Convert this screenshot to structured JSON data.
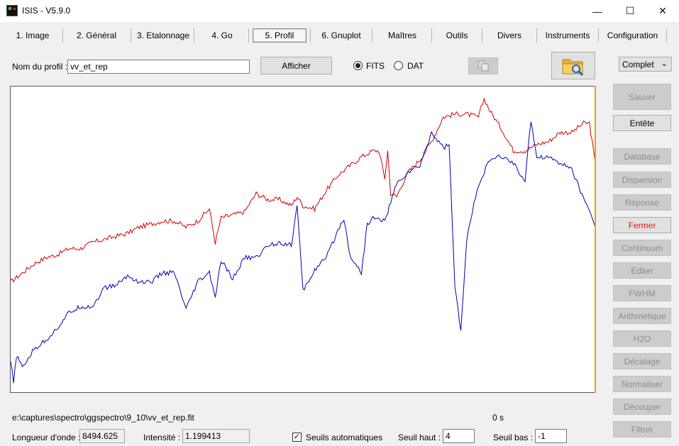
{
  "window": {
    "title": "ISIS - V5.9.0",
    "minimize_glyph": "—",
    "maximize_glyph": "☐",
    "close_glyph": "✕"
  },
  "tabs": [
    {
      "label": "1. Image"
    },
    {
      "label": "2. Général"
    },
    {
      "label": "3. Etalonnage"
    },
    {
      "label": "4. Go"
    },
    {
      "label": "5. Profil",
      "active": true
    },
    {
      "label": "6. Gnuplot"
    },
    {
      "label": "Maîtres"
    },
    {
      "label": "Outils"
    },
    {
      "label": "Divers"
    },
    {
      "label": "Instruments"
    },
    {
      "label": "Configuration"
    }
  ],
  "profile": {
    "name_label": "Nom du profil :",
    "name_value": "vv_et_rep",
    "show_button": "Afficher",
    "format_fits": "FITS",
    "format_dat": "DAT",
    "format_selected": "FITS"
  },
  "view_select": {
    "value": "Complet"
  },
  "side_buttons": [
    {
      "label": "Sauver",
      "enabled": false
    },
    {
      "label": "Entête",
      "enabled": true
    },
    {
      "label": "Database",
      "enabled": false
    },
    {
      "label": "Dispersion",
      "enabled": false
    },
    {
      "label": "Réponse",
      "enabled": false
    },
    {
      "label": "Fermer",
      "enabled": true,
      "color": "#e11111"
    },
    {
      "label": "Continuum",
      "enabled": false
    },
    {
      "label": "Editer",
      "enabled": false
    },
    {
      "label": "FWHM",
      "enabled": false
    },
    {
      "label": "Arithmétique",
      "enabled": false
    },
    {
      "label": "H2O",
      "enabled": false
    },
    {
      "label": "Décalage",
      "enabled": false
    },
    {
      "label": "Normaliser",
      "enabled": false
    },
    {
      "label": "Découper",
      "enabled": false
    },
    {
      "label": "Filtrer",
      "enabled": false
    }
  ],
  "status": {
    "file_path": "e:\\captures\\spectro\\ggspectro\\9_10\\vv_et_rep.fit",
    "elapsed": "0 s",
    "wavelength_label": "Longueur d'onde :",
    "wavelength_value": "8494.625",
    "intensity_label": "Intensité :",
    "intensity_value": "1.199413",
    "auto_threshold_label": "Seuils automatiques",
    "auto_threshold_checked": true,
    "high_threshold_label": "Seuil haut :",
    "high_threshold_value": "4",
    "low_threshold_label": "Seuil bas :",
    "low_threshold_value": "-1"
  },
  "colors": {
    "red_series": "#d00000",
    "blue_series": "#0000b4",
    "plot_edge": "#e8a100"
  },
  "chart_data": {
    "type": "line",
    "xlim": [
      0,
      100
    ],
    "ylim": [
      0,
      100
    ],
    "grid": false,
    "series": [
      {
        "color": "#d00000",
        "x": [
          0,
          2,
          4,
          6,
          8,
          10,
          12,
          14,
          16,
          18,
          20,
          22,
          24,
          26,
          28,
          30,
          32,
          34,
          35,
          36,
          38,
          40,
          42,
          44,
          46,
          48,
          49,
          50,
          52,
          54,
          56,
          58,
          60,
          62,
          63,
          64,
          64.5,
          65,
          66,
          68,
          70,
          72,
          74,
          76,
          78,
          80,
          81,
          82,
          84,
          86,
          88,
          90,
          92,
          94,
          96,
          98,
          99,
          100
        ],
        "y": [
          36,
          39,
          42,
          44,
          45,
          47,
          47,
          49,
          50,
          51,
          52,
          54,
          55,
          56,
          56,
          54,
          56,
          60,
          49,
          57,
          58,
          59,
          65,
          63,
          63,
          61,
          64,
          61,
          60,
          66,
          71,
          74,
          77,
          79,
          79,
          70,
          79,
          65,
          64,
          72,
          76,
          82,
          90,
          91,
          91,
          90,
          96,
          92,
          86,
          79,
          79,
          81,
          82,
          85,
          85,
          88,
          88,
          75
        ]
      },
      {
        "color": "#0000b4",
        "x": [
          0,
          0.5,
          1,
          2,
          4,
          6,
          8,
          10,
          12,
          14,
          16,
          18,
          20,
          22,
          24,
          26,
          28,
          30,
          32,
          34,
          35,
          36,
          38,
          40,
          42,
          44,
          46,
          48,
          49,
          50,
          52,
          54,
          56,
          57,
          58,
          60,
          61,
          62,
          64,
          66,
          68,
          70,
          72,
          74,
          75,
          76,
          77,
          77.5,
          78,
          80,
          82,
          84,
          86,
          88,
          89,
          90,
          92,
          94,
          96,
          98,
          99,
          100
        ],
        "y": [
          10,
          3,
          12,
          8,
          14,
          17,
          21,
          26,
          28,
          28,
          34,
          35,
          38,
          36,
          36,
          39,
          39,
          27,
          36,
          39,
          31,
          43,
          37,
          44,
          44,
          48,
          49,
          48,
          61,
          33,
          40,
          44,
          53,
          57,
          45,
          39,
          55,
          57,
          56,
          68,
          72,
          74,
          85,
          80,
          81,
          34,
          20,
          34,
          50,
          68,
          76,
          77,
          75,
          69,
          89,
          77,
          77,
          75,
          73,
          63,
          60,
          54
        ]
      }
    ]
  }
}
